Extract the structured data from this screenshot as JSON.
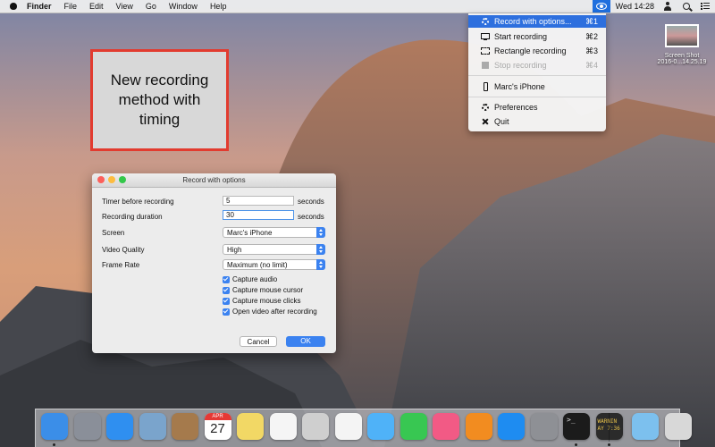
{
  "menubar": {
    "app_name": "Finder",
    "items": [
      "File",
      "Edit",
      "View",
      "Go",
      "Window",
      "Help"
    ],
    "clock": "Wed 14:28"
  },
  "annotation": {
    "text": "New recording method with timing",
    "border_color": "#e23b2f"
  },
  "status_menu": {
    "items": [
      {
        "label": "Record with options...",
        "shortcut": "⌘1",
        "icon": "gear-icon",
        "selected": true
      },
      {
        "label": "Start recording",
        "shortcut": "⌘2",
        "icon": "screen-icon"
      },
      {
        "label": "Rectangle recording",
        "shortcut": "⌘3",
        "icon": "rectangle-icon"
      },
      {
        "label": "Stop recording",
        "shortcut": "⌘4",
        "icon": "stop-icon",
        "disabled": true
      },
      {
        "label": "Marc's iPhone",
        "icon": "phone-icon"
      },
      {
        "label": "Preferences",
        "icon": "gear-icon"
      },
      {
        "label": "Quit",
        "icon": "close-icon"
      }
    ]
  },
  "desktop_file": {
    "name_line1": "Screen Shot",
    "name_line2": "2016-0...14.25.19"
  },
  "dialog": {
    "title": "Record with options",
    "timer_label": "Timer before recording",
    "timer_value": "5",
    "timer_unit": "seconds",
    "duration_label": "Recording duration",
    "duration_value": "30",
    "duration_unit": "seconds",
    "screen_label": "Screen",
    "screen_value": "Marc's iPhone",
    "quality_label": "Video Quality",
    "quality_value": "High",
    "framerate_label": "Frame Rate",
    "framerate_value": "Maximum (no limit)",
    "checkboxes": [
      {
        "label": "Capture audio",
        "checked": true
      },
      {
        "label": "Capture mouse cursor",
        "checked": true
      },
      {
        "label": "Capture mouse clicks",
        "checked": true
      },
      {
        "label": "Open video after recording",
        "checked": true
      }
    ],
    "cancel_label": "Cancel",
    "ok_label": "OK"
  },
  "dock": {
    "apps": [
      {
        "name": "finder-icon",
        "color": "#3b8ee8",
        "running": true
      },
      {
        "name": "launchpad-icon",
        "color": "#8a8f99"
      },
      {
        "name": "safari-icon",
        "color": "#2f8ff0"
      },
      {
        "name": "preview-icon",
        "color": "#7aa4cc"
      },
      {
        "name": "contacts-icon",
        "color": "#a57a4c"
      },
      {
        "name": "calendar-icon",
        "color": "#ffffff"
      },
      {
        "name": "notes-icon",
        "color": "#f2d865"
      },
      {
        "name": "reminders-icon",
        "color": "#f5f5f5"
      },
      {
        "name": "photo-booth-icon",
        "color": "#cfcfcf"
      },
      {
        "name": "photos-icon",
        "color": "#f4f4f4"
      },
      {
        "name": "messages-icon",
        "color": "#4fb2f8"
      },
      {
        "name": "facetime-icon",
        "color": "#38c752"
      },
      {
        "name": "itunes-icon",
        "color": "#f25a85"
      },
      {
        "name": "ibooks-icon",
        "color": "#f28c20"
      },
      {
        "name": "app-store-icon",
        "color": "#1e8cf1"
      },
      {
        "name": "system-preferences-icon",
        "color": "#8e9095"
      },
      {
        "name": "terminal-icon",
        "color": "#1b1b1b",
        "running": true
      },
      {
        "name": "console-icon",
        "color": "#2b2b2b",
        "running": true
      },
      {
        "name": "downloads-folder-icon",
        "color": "#7cc0ee"
      },
      {
        "name": "trash-icon",
        "color": "#d8d8d8"
      }
    ],
    "calendar_day": "27",
    "calendar_month": "APR",
    "console_text": "WARNIN AY 7:36"
  },
  "colors": {
    "accent": "#2d6fde",
    "annotation_red": "#e23b2f"
  }
}
